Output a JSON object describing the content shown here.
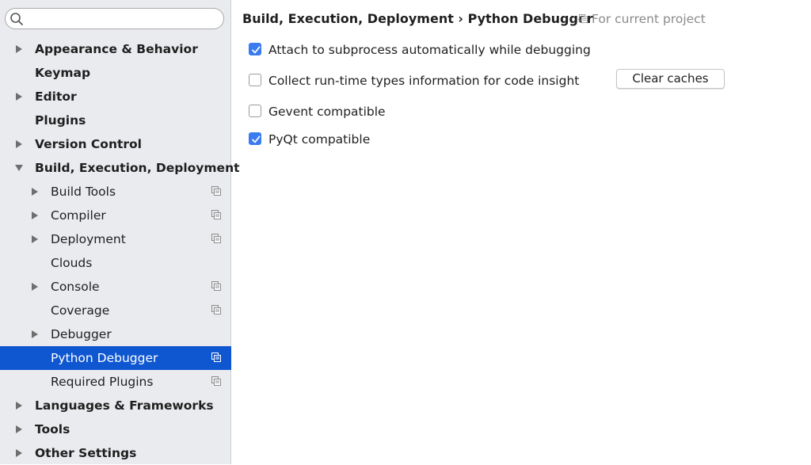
{
  "search": {
    "value": "",
    "placeholder": ""
  },
  "sidebar": {
    "items": [
      {
        "label": "Appearance & Behavior"
      },
      {
        "label": "Keymap"
      },
      {
        "label": "Editor"
      },
      {
        "label": "Plugins"
      },
      {
        "label": "Version Control"
      },
      {
        "label": "Build, Execution, Deployment"
      },
      {
        "label": "Build Tools"
      },
      {
        "label": "Compiler"
      },
      {
        "label": "Deployment"
      },
      {
        "label": "Clouds"
      },
      {
        "label": "Console"
      },
      {
        "label": "Coverage"
      },
      {
        "label": "Debugger"
      },
      {
        "label": "Python Debugger"
      },
      {
        "label": "Required Plugins"
      },
      {
        "label": "Languages & Frameworks"
      },
      {
        "label": "Tools"
      },
      {
        "label": "Other Settings"
      }
    ]
  },
  "header": {
    "breadcrumb": "Build, Execution, Deployment › Python Debugger",
    "scope": "For current project"
  },
  "options": [
    {
      "label": "Attach to subprocess automatically while debugging",
      "checked": true
    },
    {
      "label": "Collect run-time types information for code insight",
      "checked": false
    },
    {
      "label": "Gevent compatible",
      "checked": false
    },
    {
      "label": "PyQt compatible",
      "checked": true
    }
  ],
  "buttons": {
    "clear_caches": "Clear caches"
  },
  "colors": {
    "selection": "#0f56d1",
    "checkbox_accent": "#3a7bf0",
    "sidebar_bg": "#e9ebee"
  }
}
